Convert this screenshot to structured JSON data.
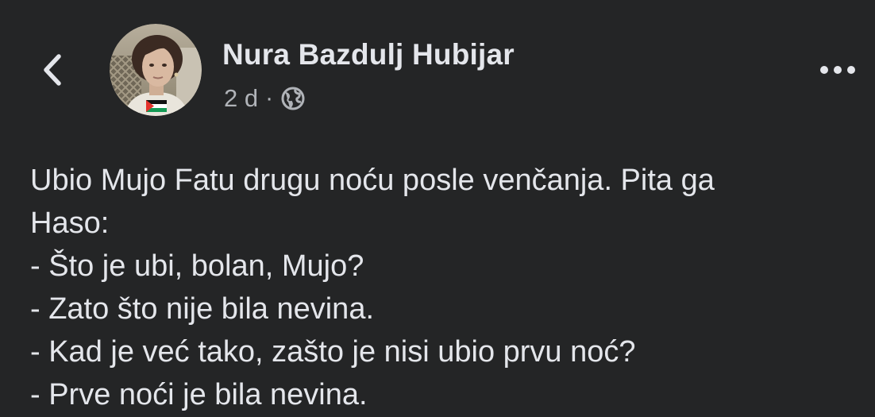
{
  "header": {
    "back_icon": "chevron-left-icon",
    "author_name": "Nura Bazdulj Hubijar",
    "time": "2 d",
    "separator": "·",
    "audience_icon": "globe-icon",
    "more_icon": "more-horizontal-icon"
  },
  "post": {
    "lines": [
      "Ubio Mujo Fatu drugu noću posle venčanja. Pita ga",
      "Haso:",
      "- Što je ubi, bolan, Mujo?",
      "- Zato što nije bila nevina.",
      "- Kad je već tako, zašto je nisi ubio prvu noć?",
      "- Prve noći je bila nevina."
    ]
  },
  "colors": {
    "background": "#242526",
    "primary_text": "#e4e6eb",
    "secondary_text": "#b0b3b8"
  }
}
